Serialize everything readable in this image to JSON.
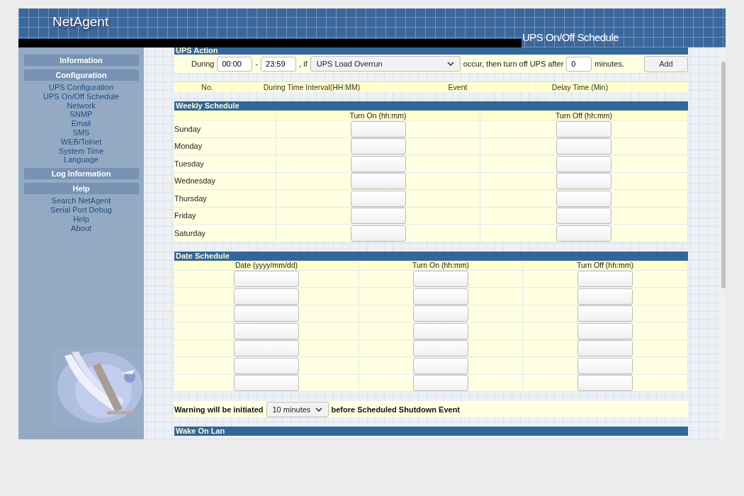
{
  "header": {
    "logo": "NetAgent",
    "page_title": "UPS On/Off Schedule"
  },
  "sidebar": {
    "sections": [
      {
        "title": "Information"
      },
      {
        "title": "Configuration",
        "items": [
          "UPS Configuration",
          "UPS On/Off Schedule",
          "Network",
          "SNMP",
          "Email",
          "SMS",
          "WEB/Telnet",
          "System Time",
          "Language"
        ]
      },
      {
        "title": "Log Information"
      },
      {
        "title": "Help",
        "items": [
          "Search NetAgent",
          "Serial Port Debug",
          "Help",
          "About"
        ]
      }
    ]
  },
  "ups_action": {
    "title": "UPS Action",
    "during_label": "During",
    "start": "00:00",
    "separator": "-",
    "end": "23:59",
    "if_label": ", if",
    "event": "UPS Load Overrun",
    "occur_label": "occur, then turn off UPS after",
    "delay": "0",
    "minutes_label": "minutes.",
    "add_button": "Add"
  },
  "action_table": {
    "columns": [
      "No.",
      "During Time Interval(HH:MM)",
      "Event",
      "Delay Time (Min)"
    ]
  },
  "weekly_schedule": {
    "title": "Weekly Schedule",
    "columns": [
      "Turn On (hh:mm)",
      "Turn Off (hh:mm)"
    ],
    "days": [
      "Sunday",
      "Monday",
      "Tuesday",
      "Wednesday",
      "Thursday",
      "Friday",
      "Saturday"
    ]
  },
  "date_schedule": {
    "title": "Date Schedule",
    "columns": [
      "Date (yyyy/mm/dd)",
      "Turn On (hh:mm)",
      "Turn Off (hh:mm)"
    ],
    "rows": [
      {
        "kind": "blank"
      },
      {
        "kind": "blank"
      },
      {
        "kind": "blank"
      },
      {
        "kind": "blank"
      },
      {
        "kind": "blank"
      },
      {
        "kind": "blank"
      },
      {
        "kind": "blank"
      }
    ]
  },
  "warning": {
    "prefix": "Warning will be initiated",
    "select": "10 minutes",
    "suffix": "before Scheduled Shutdown Event"
  },
  "wake_on_lan": {
    "title": "Wake On Lan"
  }
}
